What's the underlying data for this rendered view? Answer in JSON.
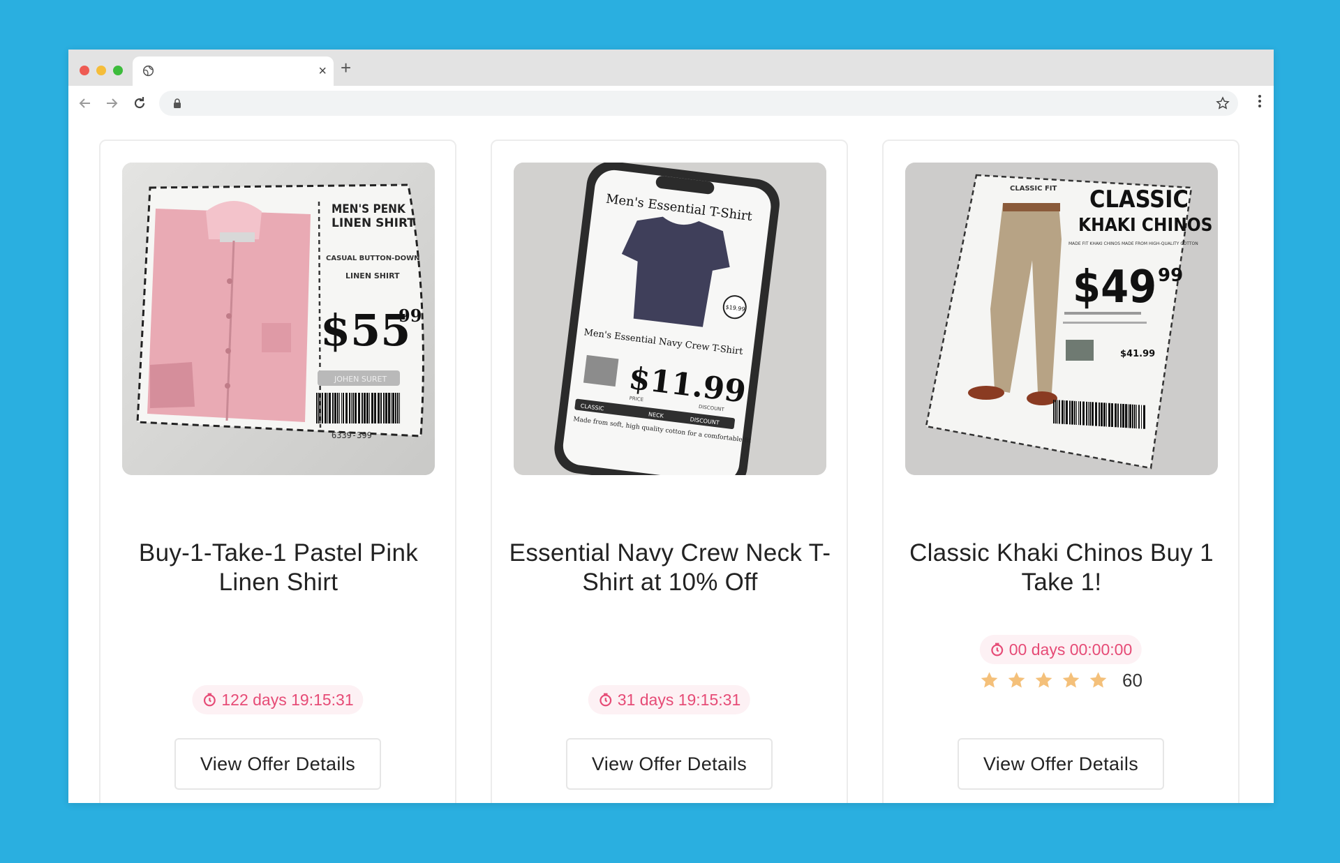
{
  "offers": [
    {
      "title": "Buy-1-Take-1 Pastel Pink Linen Shirt",
      "countdown": "122 days 19:15:31",
      "button_label": "View Offer Details",
      "coupon": {
        "name_line1": "MEN'S PENK",
        "name_line2": "LINEN SHIRT",
        "desc_line1": "CASUAL BUTTON-DOWN",
        "desc_line2": "LINEN SHIRT",
        "price_main": "$55",
        "price_cents": "99",
        "tag": "JOHEN SURET",
        "barcode_number": "6339-399"
      }
    },
    {
      "title": "Essential Navy Crew Neck T-Shirt at 10% Off",
      "countdown": "31 days 19:15:31",
      "button_label": "View Offer Details",
      "coupon": {
        "heading": "Men's Essential T-Shirt",
        "sticker": "$19.99",
        "subheading": "Men's Essential Navy Crew T-Shirt",
        "price": "$11.99",
        "price_label": "PRICE",
        "discount_label": "DISCOUNT",
        "strip_labels": [
          "CLASSIC",
          "NECK",
          "DISCOUNT"
        ],
        "footnote": "Made from soft, high quality cotton for a comfortable fit"
      }
    },
    {
      "title": "Classic Khaki Chinos Buy 1 Take 1!",
      "countdown": "00 days 00:00:00",
      "rating_count": "60",
      "rating_stars": 5,
      "button_label": "View Offer Details",
      "coupon": {
        "corner_label": "CLASSIC FIT",
        "heading_line1": "CLASSIC",
        "heading_line2": "KHAKI CHINOS",
        "subtext": "MADE FIT KHAKI CHINOS MADE FROM HIGH-QUALITY COTTON",
        "price_main": "$49",
        "price_cents": "99",
        "small_price": "$41.99"
      }
    }
  ],
  "colors": {
    "background": "#2aafe0",
    "timer_text": "#e64b76",
    "timer_bg": "#fdf1f4",
    "star": "#f4c07a"
  },
  "icons": [
    "globe-icon",
    "close-icon",
    "plus-icon",
    "back-arrow-icon",
    "forward-arrow-icon",
    "reload-icon",
    "lock-icon",
    "star-icon",
    "more-icon",
    "timer-icon",
    "rating-star-icon"
  ]
}
